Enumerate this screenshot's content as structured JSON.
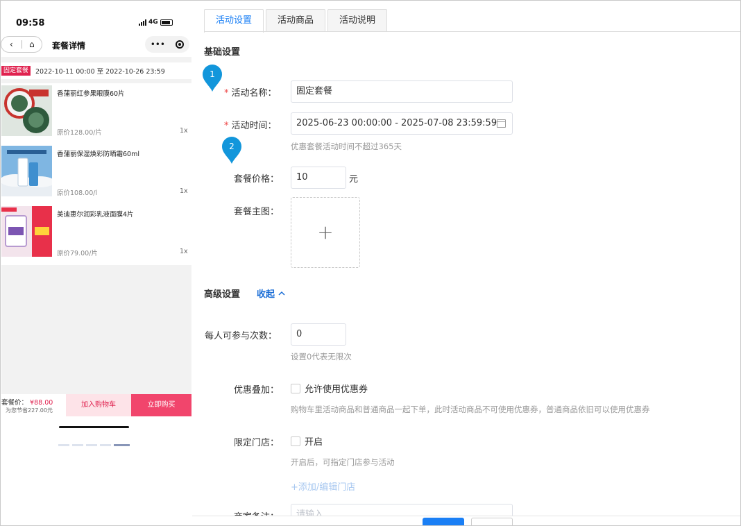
{
  "phone": {
    "status_time": "09:58",
    "network": "4G",
    "nav_title": "套餐详情",
    "nav_more": "•••",
    "period_tag": "固定套餐",
    "period_text": "2022-10-11 00:00 至 2022-10-26 23:59",
    "products": [
      {
        "name": "香蒲丽红参果眼膜60片",
        "price": "原价128.00/片",
        "qty": "1x"
      },
      {
        "name": "香蒲丽保湿焕彩防晒霜60ml",
        "price": "原价108.00/l",
        "qty": "1x"
      },
      {
        "name": "美迪惠尔润彩乳液面膜4片",
        "price": "原价79.00/片",
        "qty": "1x"
      }
    ],
    "package_price_label": "套餐价：",
    "package_price": "¥88.00",
    "save_text": "为您节省227.00元",
    "add_cart": "加入购物车",
    "buy_now": "立即购买"
  },
  "tabs": [
    {
      "label": "活动设置",
      "active": true
    },
    {
      "label": "活动商品",
      "active": false
    },
    {
      "label": "活动说明",
      "active": false
    }
  ],
  "form": {
    "basic_title": "基础设置",
    "name_label": "活动名称：",
    "name_value": "固定套餐",
    "time_label": "活动时间：",
    "time_value": "2025-06-23 00:00:00 - 2025-07-08 23:59:59",
    "time_help": "优惠套餐活动时间不超过365天",
    "price_label": "套餐价格：",
    "price_value": "10",
    "price_unit": "元",
    "image_label": "套餐主图：",
    "upload_plus": "+",
    "advanced_title": "高级设置",
    "collapse_label": "收起",
    "times_label": "每人可参与次数：",
    "times_value": "0",
    "times_help": "设置0代表无限次",
    "stack_label": "优惠叠加：",
    "stack_checkbox": "允许使用优惠券",
    "stack_help": "购物车里活动商品和普通商品一起下单，此时活动商品不可使用优惠券，普通商品依旧可以使用优惠券",
    "store_label": "限定门店：",
    "store_checkbox": "开启",
    "store_help": "开启后，可指定门店参与活动",
    "store_add": "+添加/编辑门店",
    "remark_label": "商家备注：",
    "remark_placeholder": "请输入"
  },
  "markers": [
    "1",
    "2"
  ],
  "colors": {
    "accent": "#1a7ff5",
    "marker": "#1296db",
    "brand_red": "#e0224f",
    "required": "#e44444"
  }
}
